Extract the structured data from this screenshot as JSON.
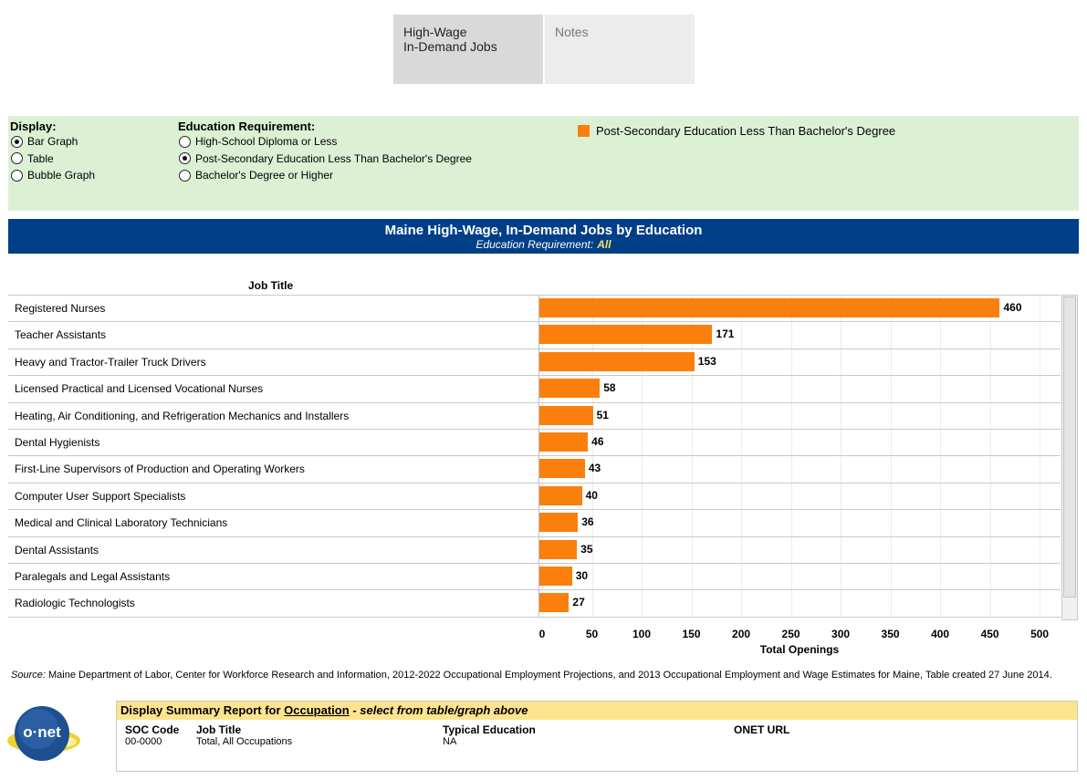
{
  "tabs": [
    {
      "label_line1": "High-Wage",
      "label_line2": "In-Demand Jobs",
      "active": true
    },
    {
      "label_line1": "Notes",
      "label_line2": "",
      "active": false
    }
  ],
  "controls": {
    "display": {
      "heading": "Display:",
      "options": [
        "Bar Graph",
        "Table",
        "Bubble Graph"
      ],
      "selected": 0
    },
    "education": {
      "heading": "Education Requirement:",
      "options": [
        "High-School Diploma or Less",
        "Post-Secondary Education Less Than Bachelor's Degree",
        "Bachelor's Degree or Higher"
      ],
      "selected": 1
    },
    "legend": {
      "label": "Post-Secondary Education Less Than Bachelor's Degree",
      "color": "#fb7f0d"
    }
  },
  "banner": {
    "title": "Maine High-Wage, In-Demand Jobs by Education",
    "subtitle": "Education Requirement:",
    "subtitle_value": "All"
  },
  "chart_data": {
    "type": "bar",
    "orientation": "horizontal",
    "column_header": "Job Title",
    "categories": [
      "Registered Nurses",
      "Teacher Assistants",
      "Heavy and Tractor-Trailer Truck Drivers",
      "Licensed Practical and Licensed Vocational Nurses",
      "Heating, Air Conditioning, and Refrigeration Mechanics and Installers",
      "Dental Hygienists",
      "First-Line Supervisors of Production and Operating Workers",
      "Computer User Support Specialists",
      "Medical and Clinical Laboratory Technicians",
      "Dental Assistants",
      "Paralegals and Legal Assistants",
      "Radiologic Technologists"
    ],
    "values": [
      460,
      171,
      153,
      58,
      51,
      46,
      43,
      40,
      36,
      35,
      30,
      27
    ],
    "xlabel": "Total Openings",
    "xlim": [
      0,
      510
    ],
    "xticks": [
      0,
      50,
      100,
      150,
      200,
      250,
      300,
      350,
      400,
      450,
      500
    ],
    "grid": true,
    "color": "#fb7f0d"
  },
  "source": {
    "label": "Source:",
    "text": "Maine Department of Labor, Center for Workforce Research and Information, 2012-2022 Occupational Employment Projections, and 2013 Occupational Employment and Wage Estimates for Maine, Table created 27 June 2014."
  },
  "logo": {
    "text": "o·net"
  },
  "summary": {
    "head_prefix": "Display Summary Report for",
    "head_link": "Occupation",
    "head_suffix": "- select from table/graph above",
    "columns": [
      "SOC Code",
      "Job Title",
      "Typical Education",
      "ONET URL"
    ],
    "row": [
      "00-0000",
      "Total, All Occupations",
      "NA",
      ""
    ]
  }
}
